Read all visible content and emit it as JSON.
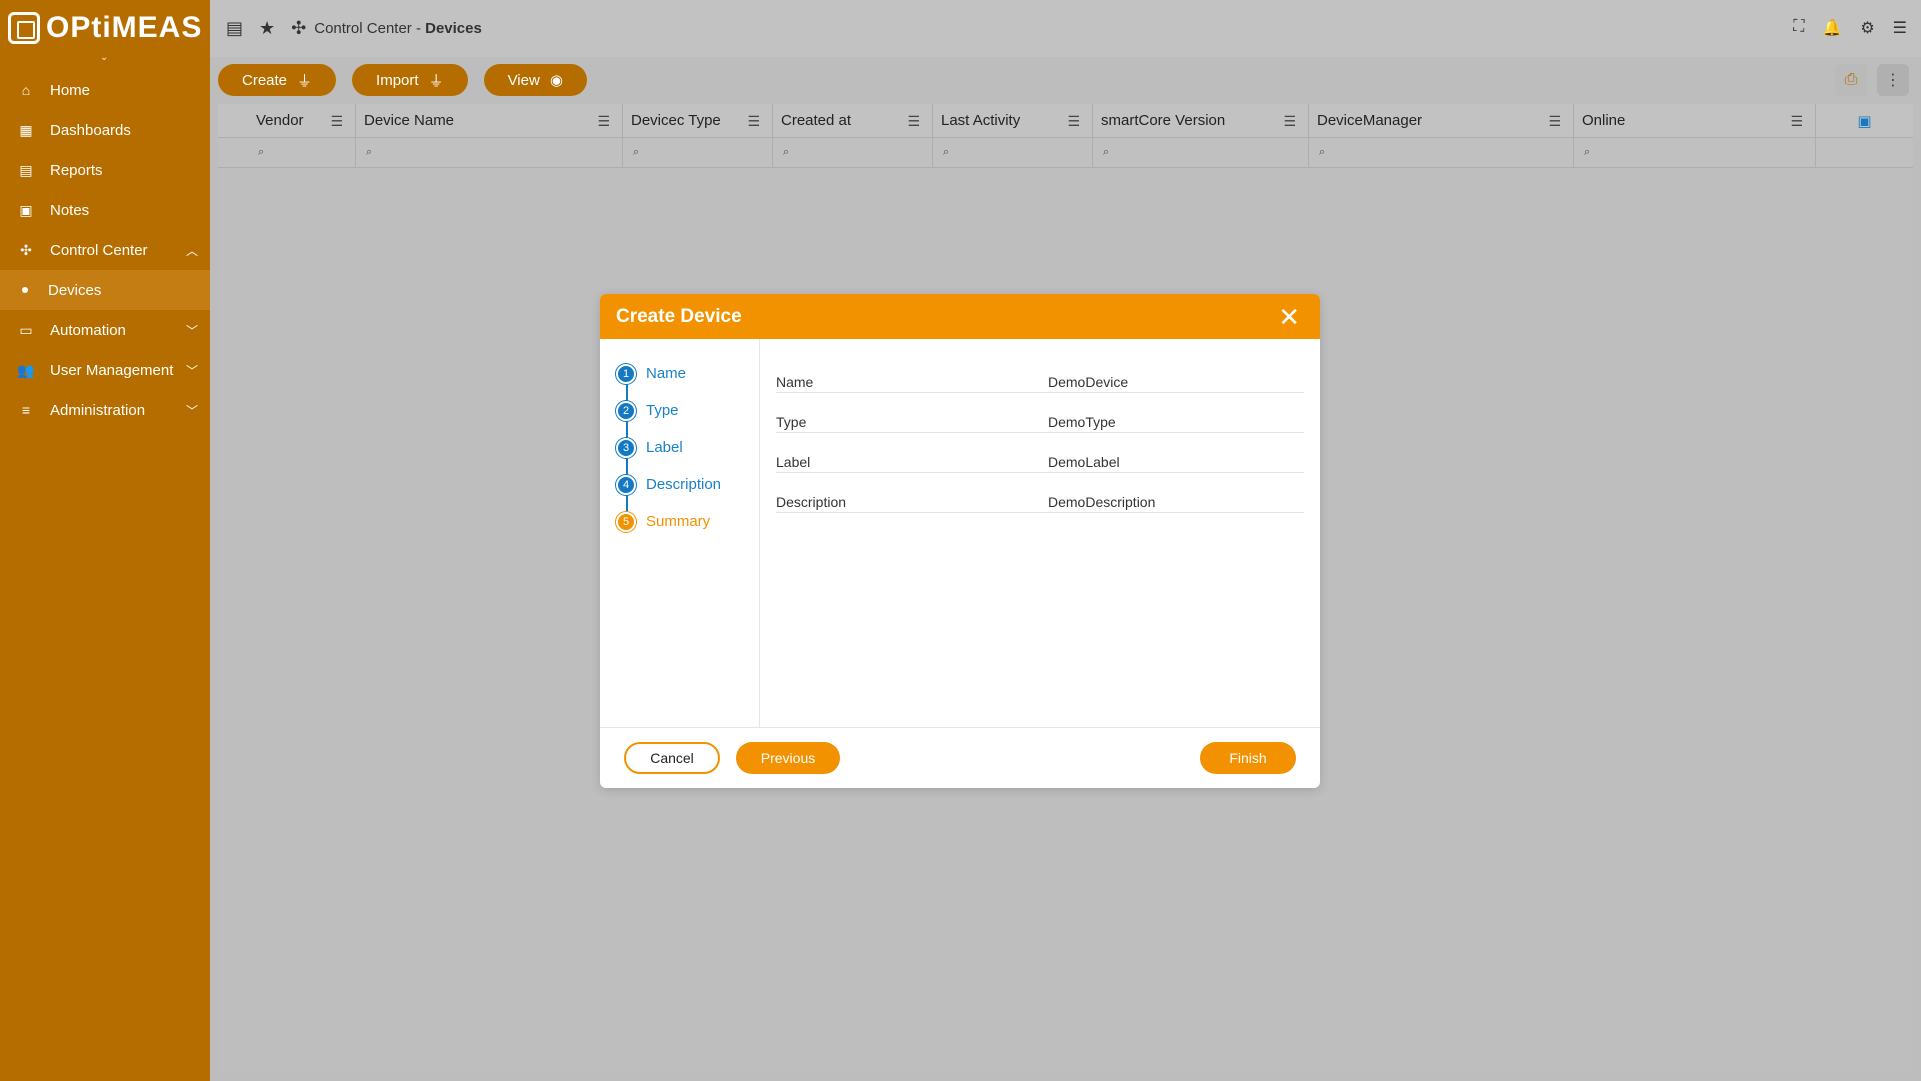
{
  "brand": {
    "name": "OPtiMEAS"
  },
  "sidebar": {
    "items": [
      {
        "label": "Home",
        "icon": "home-icon"
      },
      {
        "label": "Dashboards",
        "icon": "dashboard-icon"
      },
      {
        "label": "Reports",
        "icon": "report-icon"
      },
      {
        "label": "Notes",
        "icon": "notes-icon"
      },
      {
        "label": "Control Center",
        "icon": "network-icon",
        "expanded": true
      },
      {
        "label": "Devices",
        "active": true
      },
      {
        "label": "Automation",
        "icon": "calendar-icon"
      },
      {
        "label": "User Management",
        "icon": "users-icon"
      },
      {
        "label": "Administration",
        "icon": "admin-icon"
      }
    ]
  },
  "header": {
    "breadcrumb_section": "Control Center - ",
    "breadcrumb_page": "Devices"
  },
  "toolbar": {
    "create": "Create",
    "import": "Import",
    "view": "View"
  },
  "table": {
    "columns": [
      "Vendor",
      "Device Name",
      "Devicec Type",
      "Created at",
      "Last Activity",
      "smartCore Version",
      "DeviceManager",
      "Online"
    ]
  },
  "modal": {
    "title": "Create Device",
    "steps": [
      {
        "num": "1",
        "label": "Name"
      },
      {
        "num": "2",
        "label": "Type"
      },
      {
        "num": "3",
        "label": "Label"
      },
      {
        "num": "4",
        "label": "Description"
      },
      {
        "num": "5",
        "label": "Summary",
        "current": true
      }
    ],
    "summary": [
      {
        "key": "Name",
        "value": "DemoDevice"
      },
      {
        "key": "Type",
        "value": "DemoType"
      },
      {
        "key": "Label",
        "value": "DemoLabel"
      },
      {
        "key": "Description",
        "value": "DemoDescription"
      }
    ],
    "buttons": {
      "cancel": "Cancel",
      "previous": "Previous",
      "finish": "Finish"
    }
  },
  "colors": {
    "sidebar": "#b56d00",
    "accent": "#f39200",
    "step": "#1279c2"
  }
}
